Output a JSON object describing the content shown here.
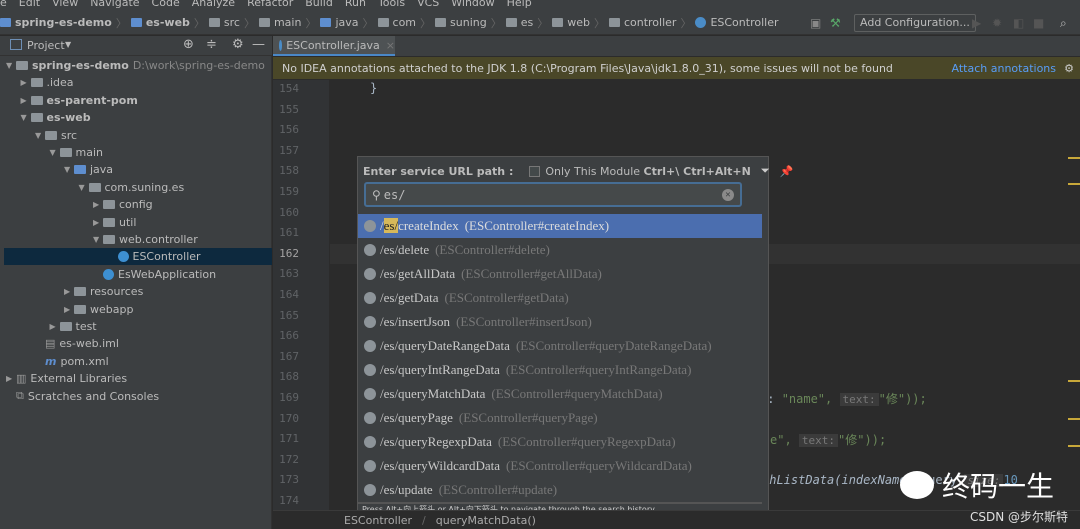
{
  "menu": [
    "e",
    "Edit",
    "View",
    "Navigate",
    "Code",
    "Analyze",
    "Refactor",
    "Build",
    "Run",
    "Tools",
    "VCS",
    "Window",
    "Help"
  ],
  "breadcrumbs": [
    "spring-es-demo",
    "es-web",
    "src",
    "main",
    "java",
    "com",
    "suning",
    "es",
    "web",
    "controller",
    "ESController"
  ],
  "toolbar": {
    "add_configuration": "Add Configuration..."
  },
  "sidebar": {
    "title": "Project",
    "tree": [
      {
        "label": "spring-es-demo",
        "extra": "D:\\work\\spring-es-demo",
        "level": 0,
        "open": true,
        "bold": true,
        "icon": "module"
      },
      {
        "label": ".idea",
        "level": 1,
        "open": false,
        "icon": "folder"
      },
      {
        "label": "es-parent-pom",
        "level": 1,
        "open": false,
        "bold": true,
        "icon": "module"
      },
      {
        "label": "es-web",
        "level": 1,
        "open": true,
        "bold": true,
        "icon": "module"
      },
      {
        "label": "src",
        "level": 2,
        "open": true,
        "icon": "folder"
      },
      {
        "label": "main",
        "level": 3,
        "open": true,
        "icon": "folder"
      },
      {
        "label": "java",
        "level": 4,
        "open": true,
        "icon": "source"
      },
      {
        "label": "com.suning.es",
        "level": 5,
        "open": true,
        "icon": "package"
      },
      {
        "label": "config",
        "level": 6,
        "open": false,
        "icon": "package"
      },
      {
        "label": "util",
        "level": 6,
        "open": false,
        "icon": "package"
      },
      {
        "label": "web.controller",
        "level": 6,
        "open": true,
        "icon": "package"
      },
      {
        "label": "ESController",
        "level": 7,
        "icon": "class",
        "selected": true
      },
      {
        "label": "EsWebApplication",
        "level": 6,
        "icon": "class"
      },
      {
        "label": "resources",
        "level": 4,
        "open": false,
        "icon": "folder"
      },
      {
        "label": "webapp",
        "level": 4,
        "open": false,
        "icon": "folder"
      },
      {
        "label": "test",
        "level": 3,
        "open": false,
        "icon": "folder"
      },
      {
        "label": "es-web.iml",
        "level": 2,
        "icon": "file"
      },
      {
        "label": "pom.xml",
        "level": 2,
        "icon": "maven"
      },
      {
        "label": "External Libraries",
        "level": 0,
        "open": false,
        "icon": "library"
      },
      {
        "label": "Scratches and Consoles",
        "level": 0,
        "icon": "scratch"
      }
    ]
  },
  "editor": {
    "tab": "ESController.java",
    "banner": "No IDEA annotations attached to the JDK 1.8 (C:\\Program Files\\Java\\jdk1.8.0_31), some issues will not be found",
    "banner_link": "Attach annotations",
    "line_numbers": [
      "154",
      "155",
      "156",
      "157",
      "158",
      "159",
      "160",
      "161",
      "162",
      "163",
      "164",
      "165",
      "166",
      "167",
      "168",
      "169",
      "170",
      "171",
      "172",
      "173",
      "174"
    ],
    "current_line": "162",
    "code_154": "}",
    "code_169_a": "e:",
    "code_169_b": "\"name\",",
    "code_169_c": "text:",
    "code_169_d": "\"修\"));",
    "code_171_a": "e\",",
    "code_171_b": "text:",
    "code_171_c": "\"修\"));",
    "code_173_a": "chListData(indexName,",
    "code_173_b": "query,",
    "code_173_c": "size:",
    "code_173_d": "10"
  },
  "popup": {
    "label": "Enter service URL path :",
    "checkbox_label": "Only This Module",
    "shortcut": "Ctrl+\\ Ctrl+Alt+N",
    "search_value": "es/",
    "highlight": "es/",
    "items": [
      {
        "path": "/es/createIndex",
        "method": "(ESController#createIndex)"
      },
      {
        "path": "/es/delete",
        "method": "(ESController#delete)"
      },
      {
        "path": "/es/getAllData",
        "method": "(ESController#getAllData)"
      },
      {
        "path": "/es/getData",
        "method": "(ESController#getData)"
      },
      {
        "path": "/es/insertJson",
        "method": "(ESController#insertJson)"
      },
      {
        "path": "/es/queryDateRangeData",
        "method": "(ESController#queryDateRangeData)"
      },
      {
        "path": "/es/queryIntRangeData",
        "method": "(ESController#queryIntRangeData)"
      },
      {
        "path": "/es/queryMatchData",
        "method": "(ESController#queryMatchData)"
      },
      {
        "path": "/es/queryPage",
        "method": "(ESController#queryPage)"
      },
      {
        "path": "/es/queryRegexpData",
        "method": "(ESController#queryRegexpData)"
      },
      {
        "path": "/es/queryWildcardData",
        "method": "(ESController#queryWildcardData)"
      },
      {
        "path": "/es/update",
        "method": "(ESController#update)"
      }
    ],
    "footer": "Press Alt+向上箭头 or Alt+向下箭头 to navigate through the search history"
  },
  "status": {
    "crumb1": "ESController",
    "crumb2": "queryMatchData()"
  },
  "watermark": {
    "text": "终码一生",
    "csdn": "CSDN @步尔斯特"
  }
}
